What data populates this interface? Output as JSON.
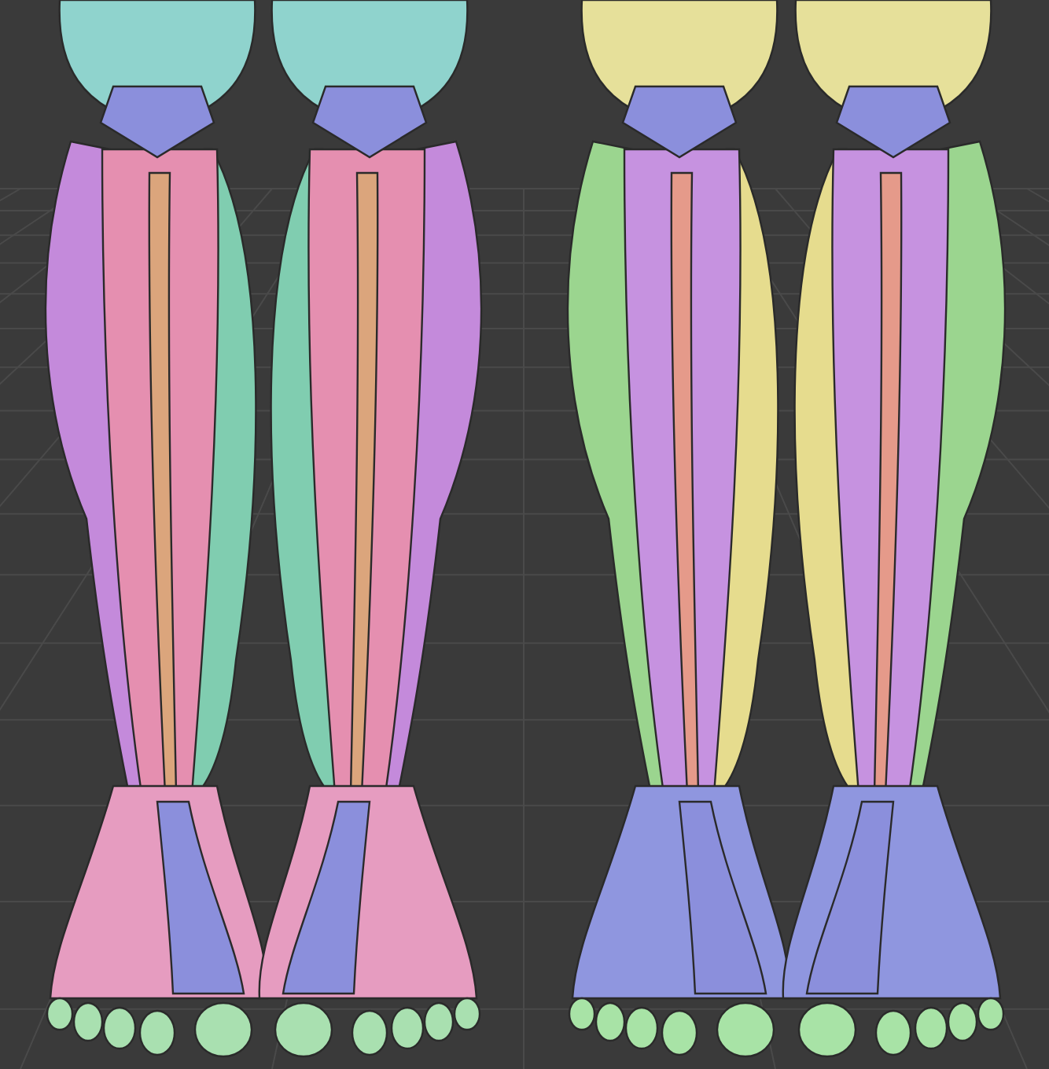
{
  "viewport": {
    "grid": true,
    "models": [
      {
        "kind": "right-leg",
        "color": "#e58fb0"
      },
      {
        "kind": "left-leg",
        "color": "#e58fb0"
      },
      {
        "kind": "right-leg",
        "color": "#c692e0"
      },
      {
        "kind": "left-leg",
        "color": "#c692e0"
      }
    ]
  }
}
